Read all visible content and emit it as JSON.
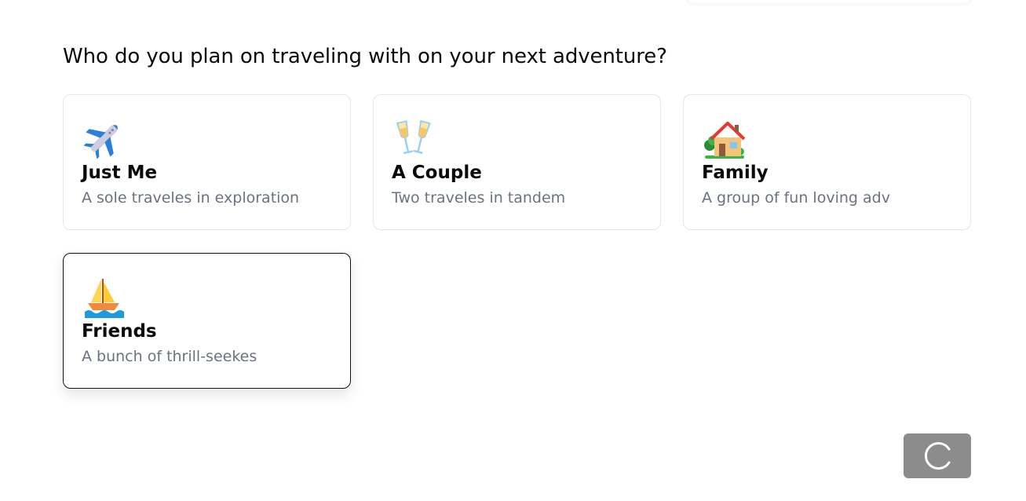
{
  "page": {
    "question": "Who do you plan on traveling with on your next adventure?"
  },
  "options": [
    {
      "title": "Just Me",
      "description": "A sole traveles in exploration",
      "icon": "airplane-icon",
      "selected": false
    },
    {
      "title": "A Couple",
      "description": "Two traveles in tandem",
      "icon": "champagne-glasses-icon",
      "selected": false
    },
    {
      "title": "Family",
      "description": "A group of fun loving adv",
      "icon": "house-with-garden-icon",
      "selected": false
    },
    {
      "title": "Friends",
      "description": "A bunch of thrill-seekes",
      "icon": "sailboat-icon",
      "selected": true
    }
  ],
  "submit": {
    "icon": "loading-spinner-icon",
    "state": "loading"
  },
  "colors": {
    "card_border": "#e5e7eb",
    "selected_border": "#111111",
    "description_text": "#6b7280",
    "button_bg": "#8c8c8c"
  }
}
